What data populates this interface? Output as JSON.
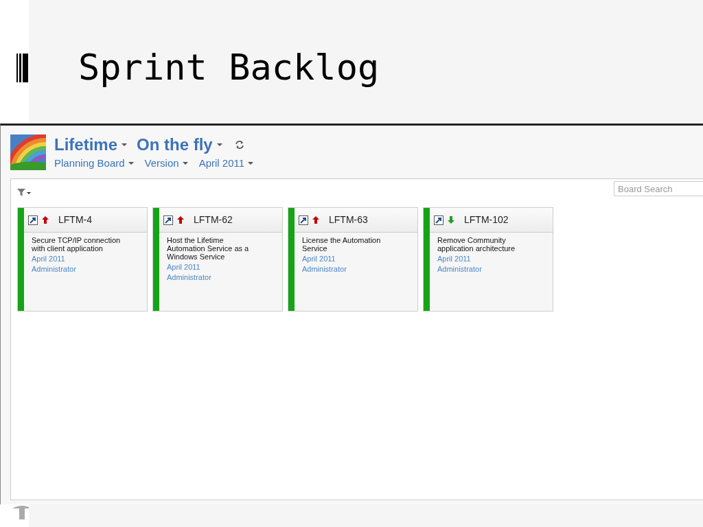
{
  "slide": {
    "title": "Sprint Backlog"
  },
  "header": {
    "project": "Lifetime",
    "board": "On the fly",
    "menus": [
      "Planning Board",
      "Version",
      "April 2011"
    ]
  },
  "search": {
    "placeholder": "Board Search"
  },
  "cards": [
    {
      "key": "LFTM-4",
      "kind": "high",
      "summary": "Secure TCP/IP connection with client application",
      "version": "April 2011",
      "assignee": "Administrator",
      "color": "#17a317"
    },
    {
      "key": "LFTM-62",
      "kind": "high",
      "summary": "Host the Lifetime Automation Service as a Windows Service",
      "version": "April 2011",
      "assignee": "Administrator",
      "color": "#17a317"
    },
    {
      "key": "LFTM-63",
      "kind": "high",
      "summary": "License the Automation Service",
      "version": "April 2011",
      "assignee": "Administrator",
      "color": "#17a317"
    },
    {
      "key": "LFTM-102",
      "kind": "low",
      "summary": "Remove Community application architecture",
      "version": "April 2011",
      "assignee": "Administrator",
      "color": "#17a317"
    }
  ]
}
